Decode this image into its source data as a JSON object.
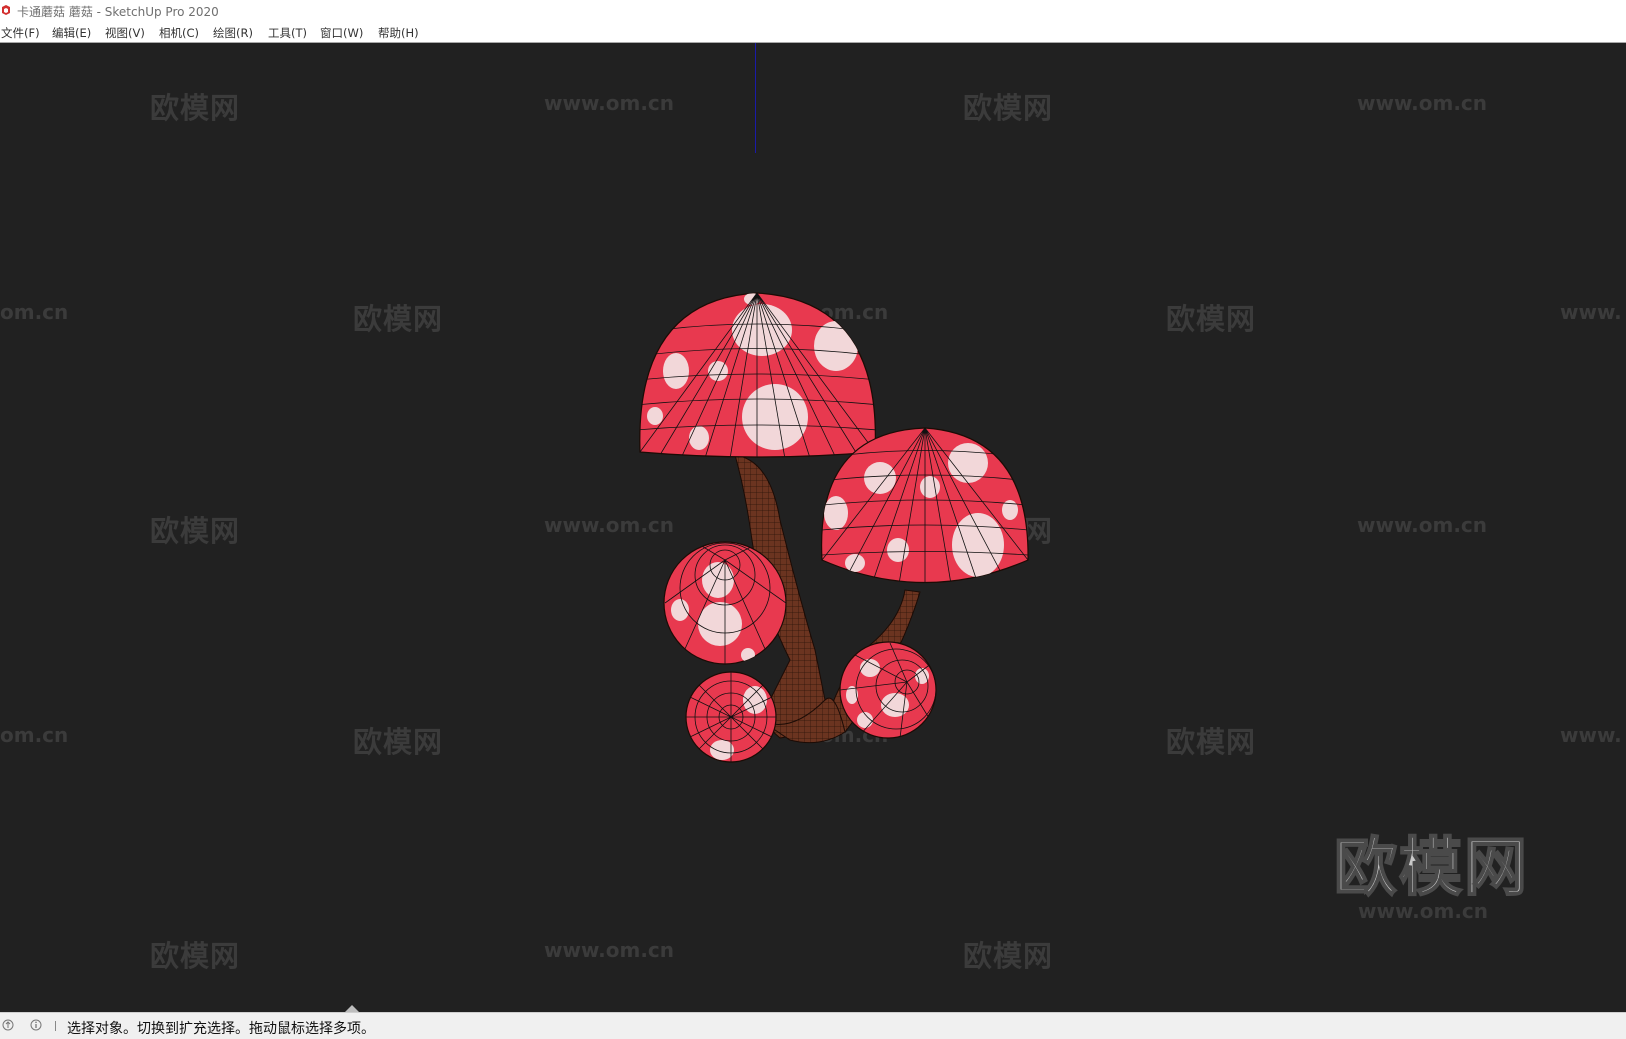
{
  "window": {
    "title": "卡通蘑菇 蘑菇 - SketchUp Pro 2020"
  },
  "menu": [
    {
      "label": "文件(F)"
    },
    {
      "label": "编辑(E)"
    },
    {
      "label": "视图(V)"
    },
    {
      "label": "相机(C)"
    },
    {
      "label": "绘图(R)"
    },
    {
      "label": "工具(T)"
    },
    {
      "label": "窗口(W)"
    },
    {
      "label": "帮助(H)"
    }
  ],
  "viewport": {
    "model": "cartoon-mushroom-cluster",
    "colors": {
      "background": "#212121",
      "cap": "#e8394f",
      "spot": "#f2d7d9",
      "stem": "#6b3420",
      "axis_blue": "#1a1aa8"
    }
  },
  "watermarks": {
    "cn": "欧模网",
    "url": "www.om.cn",
    "url_left_partial": "om.cn",
    "url_right_partial": "www."
  },
  "statusbar": {
    "text": "选择对象。切换到扩充选择。拖动鼠标选择多项。",
    "icons": [
      "geo-location-icon",
      "info-icon"
    ]
  }
}
